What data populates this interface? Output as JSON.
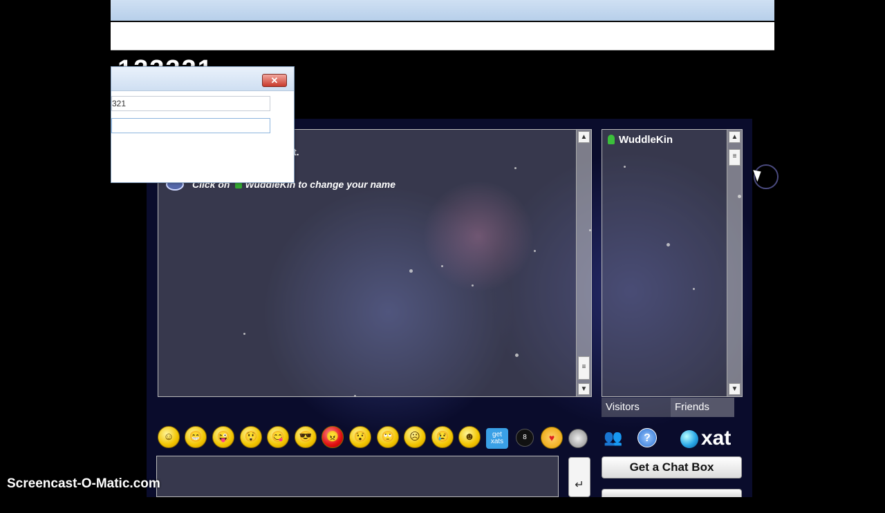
{
  "page": {
    "heading_peek": "123321"
  },
  "chat": {
    "partial_message": "t.",
    "system_message_prefix": "Click on",
    "system_message_user": "WuddleKin",
    "system_message_suffix": "to change your name"
  },
  "users": [
    {
      "name": "WuddleKin",
      "icon": "green-person-icon"
    }
  ],
  "tabs": {
    "visitors": "Visitors",
    "friends": "Friends"
  },
  "toolbar": {
    "smileys": [
      "☺",
      "😁",
      "😜",
      "😲",
      "😋",
      "😎",
      "😠",
      "😯",
      "🙄",
      "☹",
      "😢",
      "☻"
    ],
    "get_xats_label": "get xats",
    "ball_label": "8",
    "logo_text": "xat",
    "help_symbol": "?"
  },
  "input": {
    "enter_symbol": "↵"
  },
  "buttons": {
    "get_chat_box": "Get a Chat Box"
  },
  "popup": {
    "field1_value": "321",
    "field2_value": "",
    "close_symbol": "✕"
  },
  "watermark": "Screencast-O-Matic.com",
  "scroll": {
    "up": "▲",
    "down": "▼",
    "grip": "≡"
  }
}
